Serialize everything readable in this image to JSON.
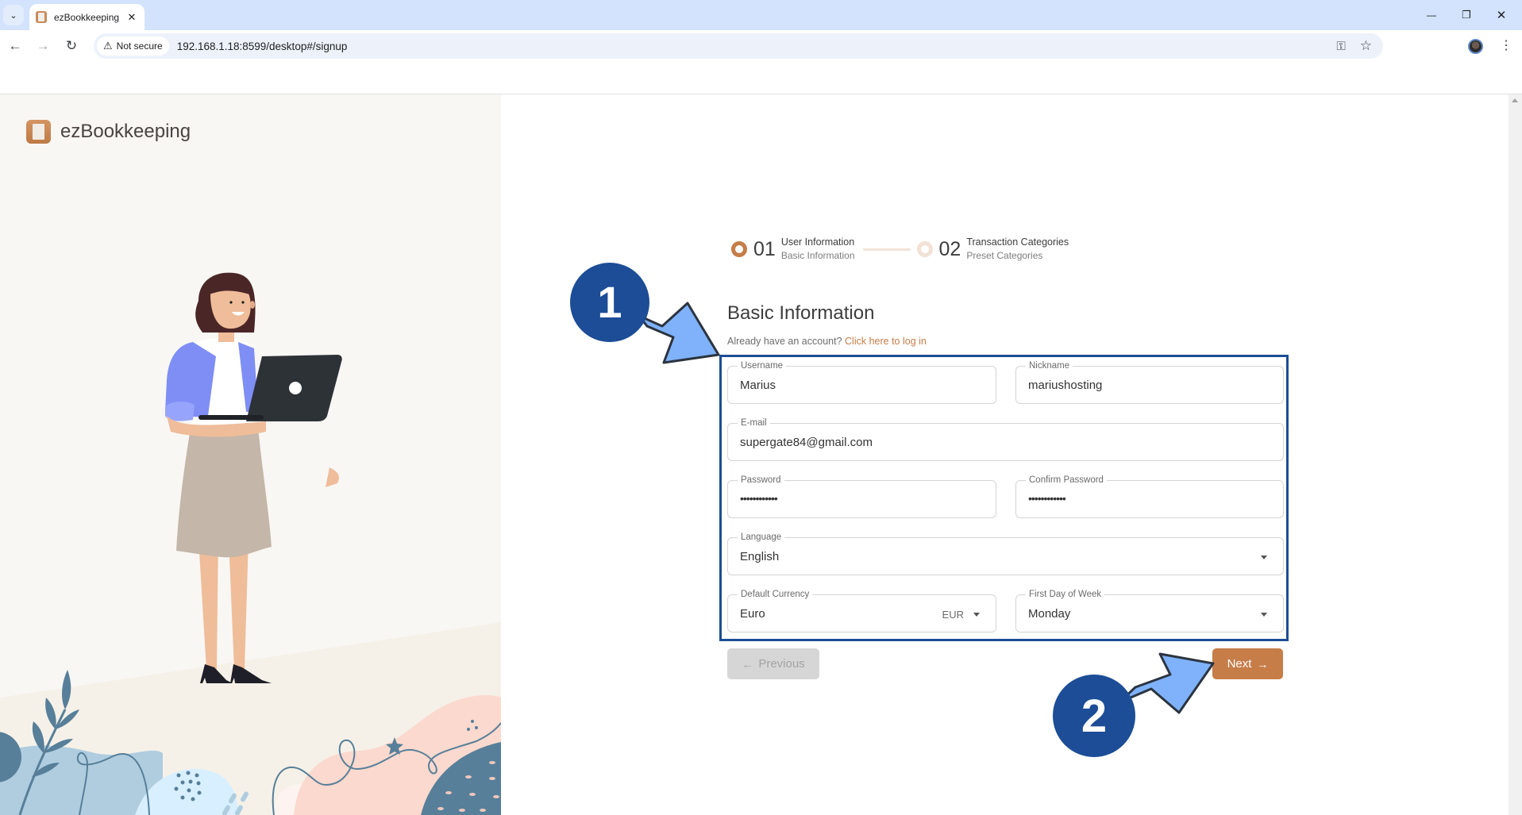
{
  "browser": {
    "tab_title": "ezBookkeeping",
    "security_label": "Not secure",
    "url": "192.168.1.18:8599/desktop#/signup",
    "icons": {
      "tab_search": "chevron-down-icon",
      "tab_close": "close-icon",
      "back": "arrow-left-icon",
      "forward": "arrow-right-icon",
      "reload": "reload-icon",
      "warning": "warning-triangle-icon",
      "password_key": "key-icon",
      "bookmark": "star-icon",
      "profile": "avatar",
      "menu": "kebab-menu-icon",
      "minimize": "minimize-icon",
      "restore": "restore-icon",
      "close_window": "close-icon"
    },
    "glyphs": {
      "tab_search": "⌄",
      "tab_close": "✕",
      "back": "←",
      "forward": "→",
      "reload": "↻",
      "warning": "⚠",
      "key": "⚿",
      "star": "☆",
      "kebab": "⋮",
      "minimize": "—",
      "restore": "❐",
      "close_window": "✕"
    }
  },
  "app": {
    "brand_name": "ezBookkeeping",
    "accent_color": "#c67d48"
  },
  "stepper": {
    "steps": [
      {
        "number": "01",
        "title": "User Information",
        "subtitle": "Basic Information",
        "active": true
      },
      {
        "number": "02",
        "title": "Transaction Categories",
        "subtitle": "Preset Categories",
        "active": false
      }
    ]
  },
  "form": {
    "title": "Basic Information",
    "login_prompt": "Already have an account?",
    "login_link": "Click here to log in",
    "fields": {
      "username": {
        "label": "Username",
        "value": "Marius"
      },
      "nickname": {
        "label": "Nickname",
        "value": "mariushosting"
      },
      "email": {
        "label": "E-mail",
        "value": "supergate84@gmail.com"
      },
      "password": {
        "label": "Password",
        "value": "••••••••••••"
      },
      "confirm_password": {
        "label": "Confirm Password",
        "value": "••••••••••••"
      },
      "language": {
        "label": "Language",
        "value": "English"
      },
      "currency": {
        "label": "Default Currency",
        "value": "Euro",
        "code": "EUR"
      },
      "first_day": {
        "label": "First Day of Week",
        "value": "Monday"
      }
    },
    "buttons": {
      "previous": "Previous",
      "previous_arrow": "←",
      "next": "Next",
      "next_arrow": "→"
    }
  },
  "annotations": {
    "markers": [
      "1",
      "2"
    ],
    "marker_color": "#1c4d96",
    "arrow_color": "#7fb2fb"
  }
}
